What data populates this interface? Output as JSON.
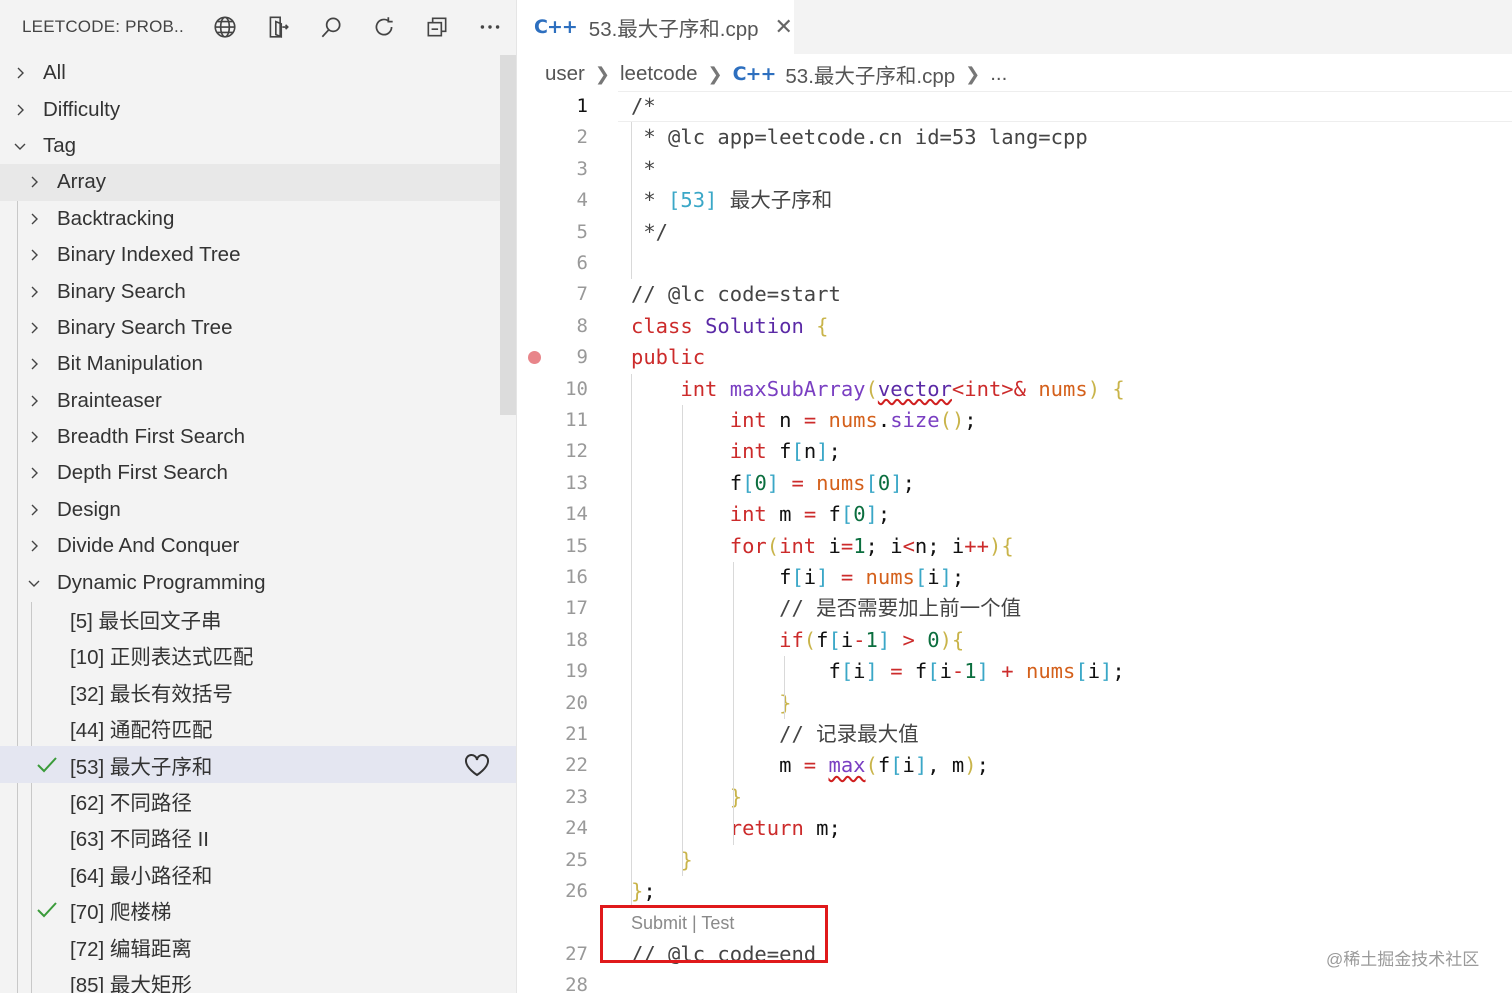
{
  "sidebar": {
    "title": "LEETCODE: PROB...",
    "header_icons": [
      "globe-icon",
      "sign-in-icon",
      "search-icon",
      "refresh-icon",
      "collapse-all-icon",
      "more-icon"
    ],
    "tree": [
      {
        "label": "All",
        "expanded": false,
        "level": 0
      },
      {
        "label": "Difficulty",
        "expanded": false,
        "level": 0
      },
      {
        "label": "Tag",
        "expanded": true,
        "level": 0
      },
      {
        "label": "Array",
        "expanded": false,
        "level": 1
      },
      {
        "label": "Backtracking",
        "expanded": false,
        "level": 1
      },
      {
        "label": "Binary Indexed Tree",
        "expanded": false,
        "level": 1
      },
      {
        "label": "Binary Search",
        "expanded": false,
        "level": 1
      },
      {
        "label": "Binary Search Tree",
        "expanded": false,
        "level": 1
      },
      {
        "label": "Bit Manipulation",
        "expanded": false,
        "level": 1
      },
      {
        "label": "Brainteaser",
        "expanded": false,
        "level": 1
      },
      {
        "label": "Breadth First Search",
        "expanded": false,
        "level": 1
      },
      {
        "label": "Depth First Search",
        "expanded": false,
        "level": 1
      },
      {
        "label": "Design",
        "expanded": false,
        "level": 1
      },
      {
        "label": "Divide And Conquer",
        "expanded": false,
        "level": 1
      },
      {
        "label": "Dynamic Programming",
        "expanded": true,
        "level": 1
      }
    ],
    "problems": [
      {
        "label": "[5] 最长回文子串",
        "solved": false
      },
      {
        "label": "[10] 正则表达式匹配",
        "solved": false
      },
      {
        "label": "[32] 最长有效括号",
        "solved": false
      },
      {
        "label": "[44] 通配符匹配",
        "solved": false
      },
      {
        "label": "[53] 最大子序和",
        "solved": true,
        "selected": true
      },
      {
        "label": "[62] 不同路径",
        "solved": false
      },
      {
        "label": "[63] 不同路径 II",
        "solved": false
      },
      {
        "label": "[64] 最小路径和",
        "solved": false
      },
      {
        "label": "[70] 爬楼梯",
        "solved": true
      },
      {
        "label": "[72] 编辑距离",
        "solved": false
      },
      {
        "label": "[85] 最大矩形",
        "solved": false
      }
    ]
  },
  "editor": {
    "tab_title": "53.最大子序和.cpp",
    "cpp_icon_text": "C++",
    "breadcrumb": [
      "user",
      "leetcode",
      "53.最大子序和.cpp",
      "..."
    ],
    "active_line": 1,
    "breakpoint_line": 9,
    "line_numbers": [
      "1",
      "2",
      "3",
      "4",
      "5",
      "6",
      "7",
      "8",
      "9",
      "10",
      "11",
      "12",
      "13",
      "14",
      "15",
      "16",
      "17",
      "18",
      "19",
      "20",
      "21",
      "22",
      "23",
      "24",
      "25",
      "26",
      "27",
      "28"
    ],
    "codelens": "Submit | Test",
    "code_lines": [
      "/*",
      " * @lc app=leetcode.cn id=53 lang=cpp",
      " *",
      " * [53] 最大子序和",
      " */",
      "",
      "// @lc code=start",
      "class Solution {",
      "public:",
      "    int maxSubArray(vector<int>& nums) {",
      "        int n = nums.size();",
      "        int f[n];",
      "        f[0] = nums[0];",
      "        int m = f[0];",
      "        for(int i=1; i<n; i++){",
      "            f[i] = nums[i];",
      "            // 是否需要加上前一个值",
      "            if(f[i-1] > 0){",
      "                f[i] = f[i-1] + nums[i];",
      "            }",
      "            // 记录最大值",
      "            m = max(f[i], m);",
      "        }",
      "        return m;",
      "    }",
      "};",
      "// @lc code=end",
      ""
    ]
  },
  "watermark": "@稀土掘金技术社区"
}
